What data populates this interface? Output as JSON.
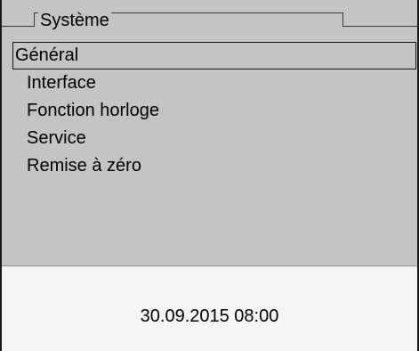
{
  "header": {
    "title": "Système"
  },
  "menu": {
    "items": [
      {
        "label": "Général",
        "selected": true
      },
      {
        "label": "Interface",
        "selected": false
      },
      {
        "label": "Fonction horloge",
        "selected": false
      },
      {
        "label": "Service",
        "selected": false
      },
      {
        "label": "Remise à zéro",
        "selected": false
      }
    ]
  },
  "status": {
    "datetime": "30.09.2015 08:00"
  },
  "colors": {
    "panel_background": "#c4c4c4",
    "status_background": "#f3f5f7",
    "selection_border": "#111111"
  }
}
